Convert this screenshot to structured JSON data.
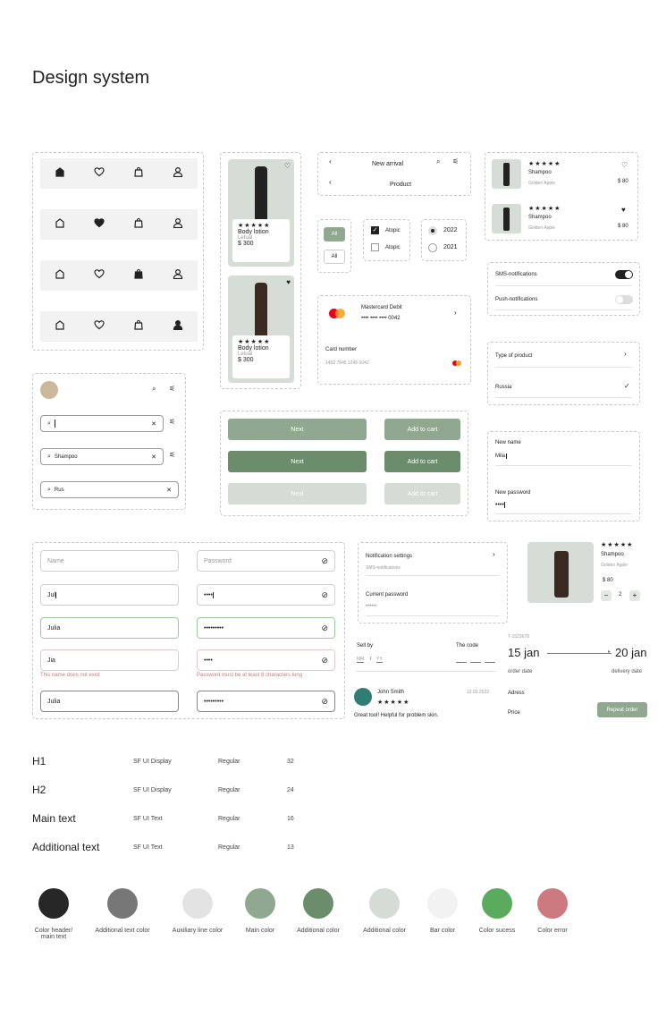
{
  "title": "Design system",
  "products": [
    {
      "name": "Body lotion",
      "brand": "Letual",
      "price": "$ 300",
      "stars": "★★★★★"
    },
    {
      "name": "Body lotion",
      "brand": "Letual",
      "price": "$ 300",
      "stars": "★★★★★"
    }
  ],
  "header": {
    "new_arrival": "New arrival",
    "product": "Product"
  },
  "chips": {
    "active": "All",
    "inactive": "All"
  },
  "checkboxes": [
    "Atopic",
    "Atopic"
  ],
  "radios": [
    "2022",
    "2021"
  ],
  "card": {
    "name": "Mastercard Debit",
    "masked": "•••• •••• •••• 0042",
    "label": "Card number",
    "number": "1452 7845 1245 0042"
  },
  "list_products": [
    {
      "stars": "★★★★★",
      "name": "Shampoo",
      "brand": "Golden Apple",
      "price": "$ 80"
    },
    {
      "stars": "★★★★★",
      "name": "Shampoo",
      "brand": "Golden Apple",
      "price": "$ 80"
    }
  ],
  "notifications": {
    "sms": "SMS-notifications",
    "push": "Push-notifications",
    "sms_on": true,
    "push_on": false
  },
  "selection": {
    "type": "Type of product",
    "country": "Russia"
  },
  "profile_edit": {
    "name_label": "New name",
    "name_value": "Mila",
    "password_label": "New password",
    "password_value": "••••"
  },
  "search": {
    "values": [
      "",
      "Shampoo",
      "Rus"
    ]
  },
  "buttons": {
    "next": "Next",
    "add": "Add to cart"
  },
  "inputs": {
    "left": [
      {
        "value": "Name",
        "placeholder": true
      },
      {
        "value": "Jul"
      },
      {
        "value": "Julia"
      },
      {
        "value": "Jia"
      },
      {
        "value": "Julia"
      }
    ],
    "right": [
      {
        "value": "Password",
        "placeholder": true
      },
      {
        "value": "••••"
      },
      {
        "value": "•••••••••"
      },
      {
        "value": "••••"
      },
      {
        "value": "•••••••••"
      }
    ],
    "name_error": "This name does not exist",
    "password_error": "Password must be at least 8 characters long"
  },
  "settings": {
    "title": "Notification settings",
    "sub": "SMS-notifications",
    "current_password": "Current password",
    "password_mask": "••••••"
  },
  "detail": {
    "stars": "★★★★★",
    "name": "Shampoo",
    "brand": "Golden Apple",
    "price": "$ 80",
    "qty": "2",
    "minus": "−",
    "plus": "+"
  },
  "payment": {
    "sell_by": "Sell by",
    "mm": "MM",
    "slash": "/",
    "yy": "YY",
    "code": "The code"
  },
  "order": {
    "id": "T-1523678",
    "from": "15 jan",
    "to": "20 jan",
    "order_date": "order date",
    "delivery_date": "delivery date",
    "address": "Adress",
    "price": "Price",
    "repeat": "Repeat order"
  },
  "review": {
    "name": "John Smith",
    "date": "12.03.2022",
    "stars": "★★★★★",
    "text": "Great tool! Helpful for problem skin."
  },
  "typography": [
    {
      "name": "H1",
      "font": "SF UI Display",
      "weight": "Regular",
      "size": "32"
    },
    {
      "name": "H2",
      "font": "SF UI Display",
      "weight": "Regular",
      "size": "24"
    },
    {
      "name": "Main text",
      "font": "SF UI Text",
      "weight": "Regular",
      "size": "16"
    },
    {
      "name": "Additional text",
      "font": "SF UI Text",
      "weight": "Regular",
      "size": "13"
    }
  ],
  "colors": [
    {
      "label": "Color header/ main text",
      "hex": "#272727"
    },
    {
      "label": "Additional text color",
      "hex": "#777777"
    },
    {
      "label": "Auxiliary line color",
      "hex": "#e3e3e3"
    },
    {
      "label": "Main color",
      "hex": "#8fa88f"
    },
    {
      "label": "Additional color",
      "hex": "#6c8d6c"
    },
    {
      "label": "Additional color",
      "hex": "#d5dcd5"
    },
    {
      "label": "Bar color",
      "hex": "#f1f2f1"
    },
    {
      "label": "Color sucess",
      "hex": "#5aab5e"
    },
    {
      "label": "Color error",
      "hex": "#cc7a80"
    }
  ]
}
